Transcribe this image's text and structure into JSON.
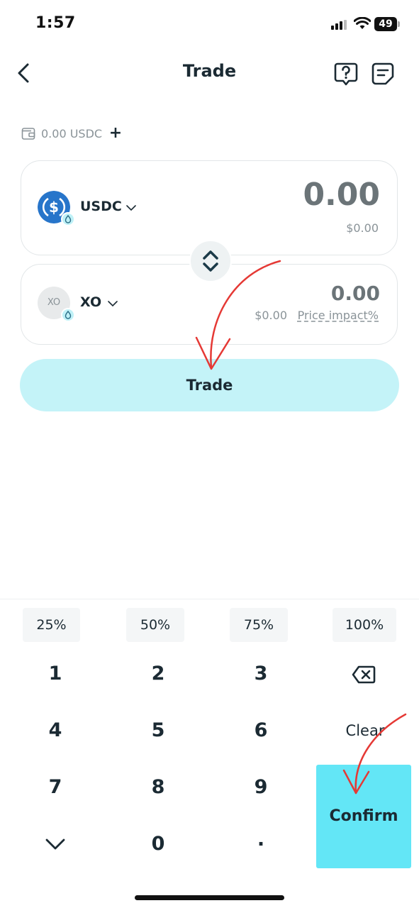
{
  "status_bar": {
    "time": "1:57",
    "battery": "49"
  },
  "header": {
    "title": "Trade"
  },
  "balance": {
    "text": "0.00 USDC",
    "add": "+"
  },
  "from_token": {
    "symbol": "USDC",
    "amount": "0.00",
    "fiat": "$0.00"
  },
  "to_token": {
    "symbol": "XO",
    "icon_text": "XO",
    "amount": "0.00",
    "fiat": "$0.00",
    "price_impact": "Price impact%"
  },
  "trade_button": "Trade",
  "keypad": {
    "percents": [
      "25%",
      "50%",
      "75%",
      "100%"
    ],
    "digits": [
      "1",
      "2",
      "3",
      "4",
      "5",
      "6",
      "7",
      "8",
      "9",
      "0"
    ],
    "dot": ".",
    "clear": "Clear",
    "confirm": "Confirm"
  },
  "colors": {
    "accent": "#63e6f6",
    "trade_button_bg": "#c4f3f8",
    "usdc_blue": "#2775ca",
    "annotation_red": "#e53935"
  },
  "icons": [
    "back-arrow-icon",
    "help-icon",
    "notes-icon",
    "wallet-icon",
    "plus-icon",
    "usdc-icon",
    "drop-badge-icon",
    "chevron-down-icon",
    "swap-icon",
    "backspace-icon",
    "keyboard-hide-icon"
  ]
}
